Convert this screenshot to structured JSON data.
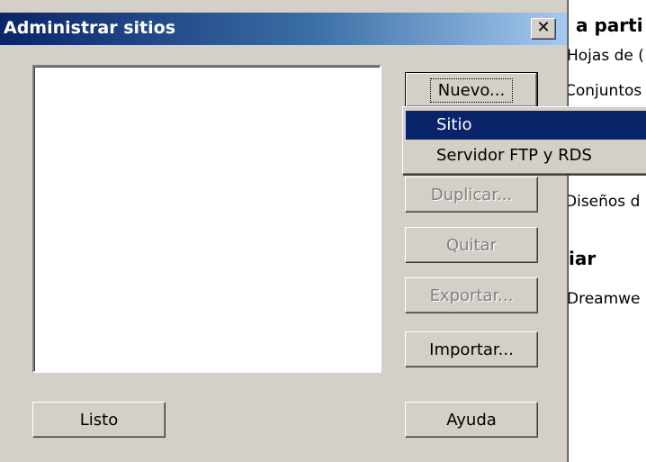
{
  "dialog": {
    "title": "Administrar sitios",
    "close_glyph": "✕"
  },
  "buttons": {
    "new": "Nuevo...",
    "duplicate": "Duplicar...",
    "remove": "Quitar",
    "export": "Exportar...",
    "import": "Importar...",
    "done": "Listo",
    "help": "Ayuda"
  },
  "new_menu": {
    "items": [
      "Sitio",
      "Servidor FTP y RDS"
    ],
    "selected_index": 0
  },
  "background_page": {
    "heading1": "a parti",
    "line1": "Hojas de (",
    "line2": "Conjuntos",
    "line3": "Diseños d",
    "heading2": "iar",
    "line4": "Dreamwe"
  },
  "colors": {
    "dialog_face": "#d4d0c8",
    "title_start": "#0a246a",
    "title_end": "#a6caf0",
    "menu_highlight": "#0a246a"
  }
}
